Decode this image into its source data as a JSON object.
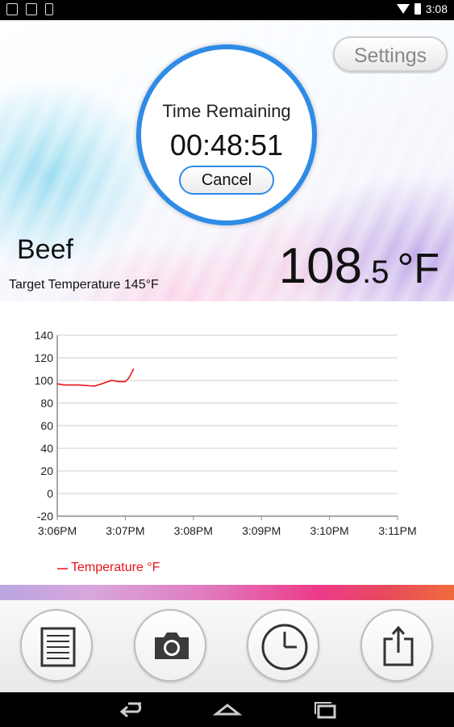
{
  "status_bar": {
    "time": "3:08",
    "notification_icons": [
      "app-notification-icon",
      "image-notification-icon",
      "device-notification-icon"
    ],
    "system_icons": [
      "wifi-icon",
      "battery-icon"
    ]
  },
  "header": {
    "settings_label": "Settings"
  },
  "timer": {
    "label": "Time Remaining",
    "value": "00:48:51",
    "cancel_label": "Cancel"
  },
  "food": {
    "name": "Beef",
    "target_temperature": "Target Temperature 145°F"
  },
  "current_temperature": {
    "integer": "108",
    "decimal": ".5",
    "unit": "°F"
  },
  "colors": {
    "accent": "#2e8be6",
    "series": "#e8141c"
  },
  "chart_data": {
    "type": "line",
    "x_tick_labels": [
      "3:06PM",
      "3:07PM",
      "3:08PM",
      "3:09PM",
      "3:10PM",
      "3:11PM"
    ],
    "y_tick_labels": [
      "140",
      "120",
      "100",
      "80",
      "60",
      "40",
      "20",
      "0",
      "-20"
    ],
    "ylim": [
      -20,
      140
    ],
    "xlim_minutes": [
      0,
      5
    ],
    "grid": true,
    "legend_position": "bottom-left",
    "series": [
      {
        "name": "Temperature °F",
        "color": "#e8141c",
        "x_minutes": [
          0,
          0.1,
          0.3,
          0.55,
          0.7,
          0.8,
          0.9,
          1.0,
          1.05,
          1.12
        ],
        "y": [
          97,
          96,
          96,
          95,
          98,
          100,
          99,
          99,
          102,
          110
        ]
      }
    ]
  },
  "toolbar": {
    "buttons": [
      "notes-icon",
      "camera-icon",
      "clock-icon",
      "share-icon"
    ]
  },
  "navbar": {
    "buttons": [
      "back-icon",
      "home-icon",
      "recent-apps-icon"
    ]
  }
}
